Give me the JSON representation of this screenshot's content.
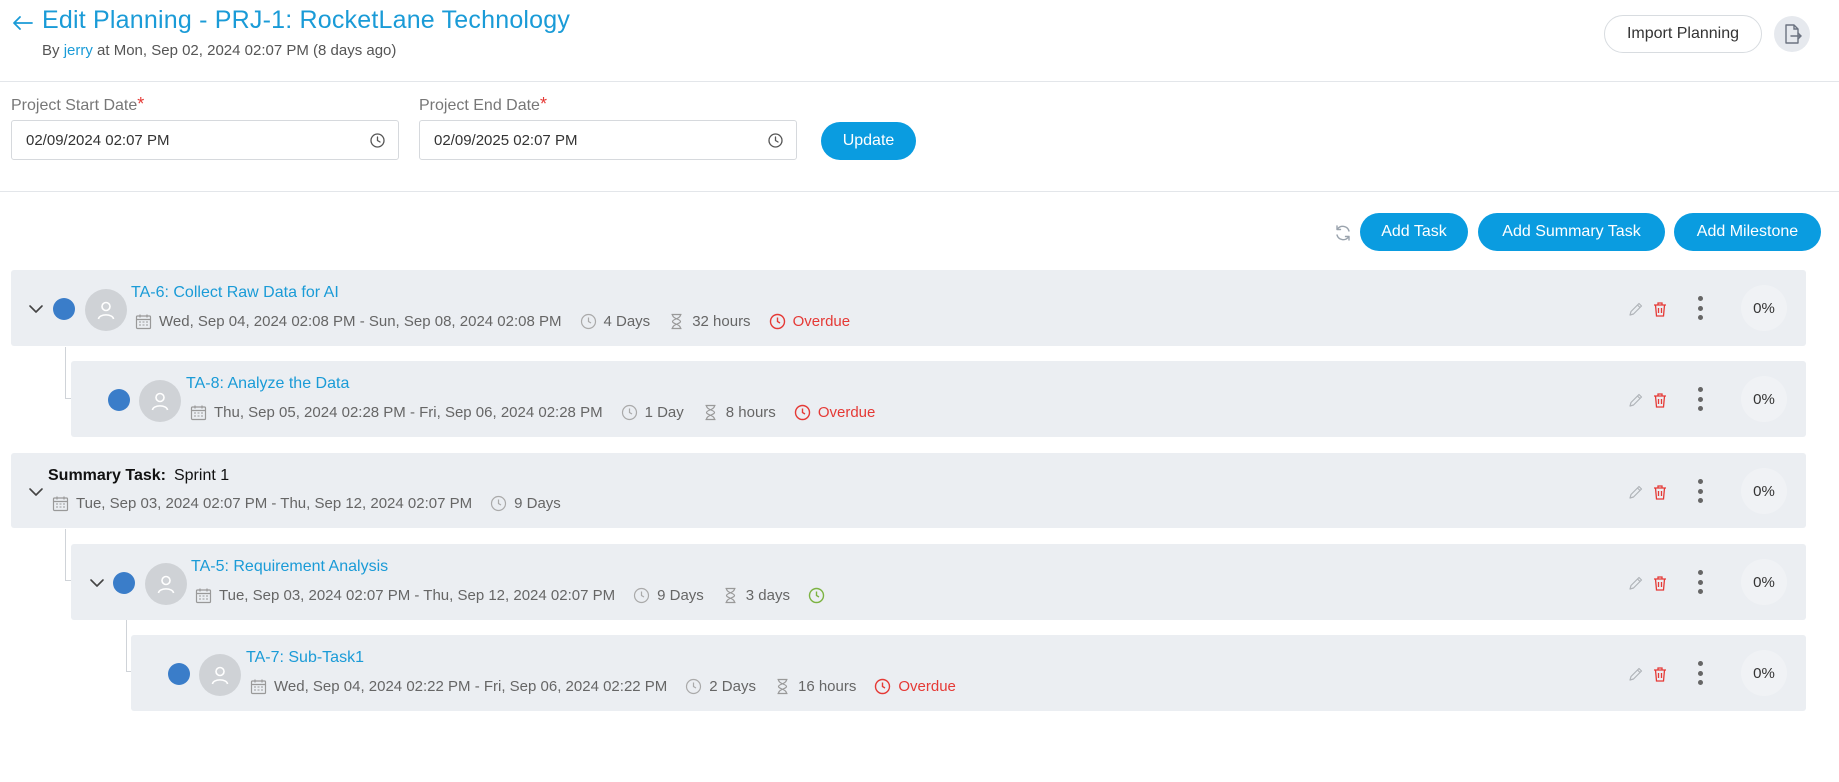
{
  "header": {
    "title": "Edit Planning - PRJ-1: RocketLane Technology",
    "by_prefix": "By",
    "user": "jerry",
    "timestamp": "at Mon, Sep 02, 2024 02:07 PM (8 days ago)",
    "import_label": "Import Planning"
  },
  "dates": {
    "start_label": "Project Start Date",
    "start_value": "02/09/2024 02:07 PM",
    "end_label": "Project End Date",
    "end_value": "02/09/2025 02:07 PM",
    "required_mark": "*",
    "update_label": "Update"
  },
  "toolbar": {
    "add_task": "Add Task",
    "add_summary_task": "Add Summary Task",
    "add_milestone": "Add Milestone"
  },
  "tasks": [
    {
      "title": "TA-6: Collect Raw Data for AI",
      "date_range": "Wed, Sep 04, 2024 02:08 PM - Sun, Sep 08, 2024 02:08 PM",
      "duration": "4 Days",
      "hours": "32 hours",
      "status": "Overdue",
      "progress": "0%"
    },
    {
      "title": "TA-8: Analyze the Data",
      "date_range": "Thu, Sep 05, 2024 02:28 PM - Fri, Sep 06, 2024 02:28 PM",
      "duration": "1 Day",
      "hours": "8 hours",
      "status": "Overdue",
      "progress": "0%"
    },
    {
      "summary_prefix": "Summary Task:",
      "title": "Sprint 1",
      "date_range": "Tue, Sep 03, 2024 02:07 PM - Thu, Sep 12, 2024 02:07 PM",
      "duration": "9 Days",
      "progress": "0%"
    },
    {
      "title": "TA-5: Requirement Analysis",
      "date_range": "Tue, Sep 03, 2024 02:07 PM - Thu, Sep 12, 2024 02:07 PM",
      "duration": "9 Days",
      "hours": "3 days",
      "status": "",
      "progress": "0%"
    },
    {
      "title": "TA-7: Sub-Task1",
      "date_range": "Wed, Sep 04, 2024 02:22 PM - Fri, Sep 06, 2024 02:22 PM",
      "duration": "2 Days",
      "hours": "16 hours",
      "status": "Overdue",
      "progress": "0%"
    }
  ],
  "colors": {
    "accent": "#0a9ce0",
    "link": "#1a9bd7",
    "overdue": "#e53935",
    "on_track": "#7cb342",
    "dot": "#3a7dc9",
    "row_bg": "#ebeef2"
  }
}
